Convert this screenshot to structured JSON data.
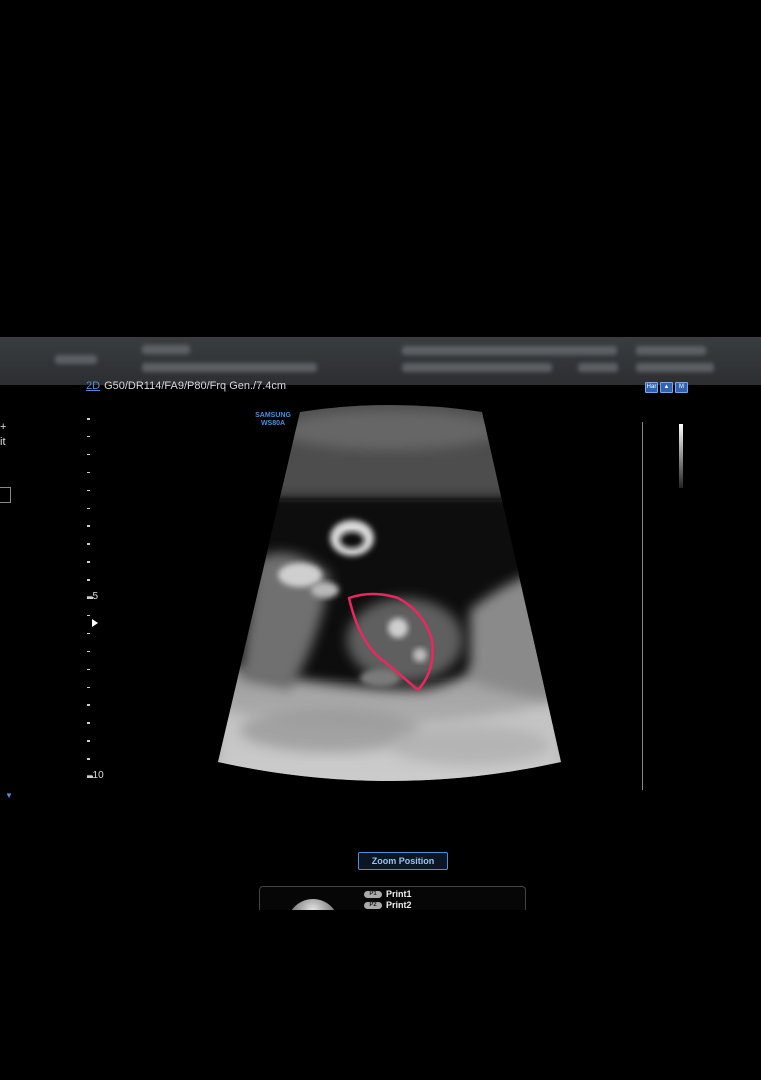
{
  "header": {
    "redacted": true
  },
  "imaging_params": {
    "mode": "2D",
    "params": "G50/DR114/FA9/P80/Frq Gen./7.4cm"
  },
  "brand": {
    "line1": "SAMSUNG",
    "line2": "WS80A"
  },
  "left_panel": {
    "line1": "+",
    "line2": "it"
  },
  "depth_scale": {
    "labels": [
      "5",
      "10"
    ],
    "max_cm": 10
  },
  "right_icons": [
    "Har",
    "▲",
    "M"
  ],
  "zoom_button": {
    "label": "Zoom Position"
  },
  "print_panel": {
    "items": [
      {
        "tag": "P1",
        "label": "Print1"
      },
      {
        "tag": "P2",
        "label": "Print2"
      }
    ]
  },
  "colors": {
    "annotation": "#e8285f",
    "accent": "#4f8fd6"
  }
}
